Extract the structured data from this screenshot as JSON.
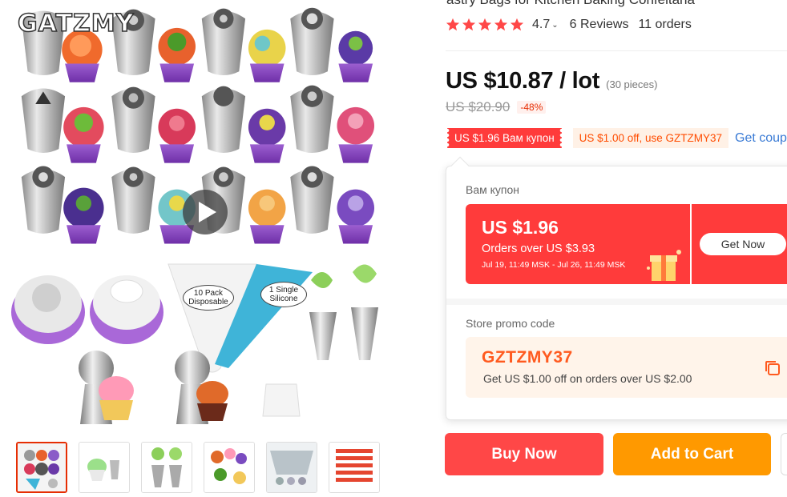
{
  "gallery": {
    "brand": "GATZMY",
    "bag_labels": {
      "disposable": "10 Pack\nDisposable",
      "silicone": "1 Single\nSilicone"
    },
    "thumbnail_count": 6
  },
  "product": {
    "title_fragment": "astry Bags for Kitchen Baking Confeitaria",
    "rating": "4.7",
    "rating_stars": 5,
    "reviews": "6 Reviews",
    "orders": "11 orders",
    "price": "US $10.87 / lot",
    "pieces": "(30 pieces)",
    "old_price": "US $20.90",
    "discount": "-48%"
  },
  "coupons": {
    "store_coupon_tag": "US $1.96 Вам купон",
    "promo_tag": "US $1.00 off, use GZTZMY37",
    "get_coupons": "Get coupons"
  },
  "popover": {
    "coupon_section_title": "Вам купон",
    "coupon_amount": "US $1.96",
    "coupon_condition": "Orders over US $3.93",
    "coupon_dates": "Jul 19, 11:49 MSK - Jul 26, 11:49 MSK",
    "get_now": "Get Now",
    "promo_section_title": "Store promo code",
    "promo_code": "GZTZMY37",
    "promo_desc": "Get US $1.00 off on orders over US $2.00"
  },
  "actions": {
    "buy_now": "Buy Now",
    "add_to_cart": "Add to Cart"
  },
  "colors": {
    "accent_red": "#ff4747",
    "accent_orange": "#ff9900",
    "promo_orange": "#ff5a1f",
    "link_blue": "#3a7bd5"
  }
}
